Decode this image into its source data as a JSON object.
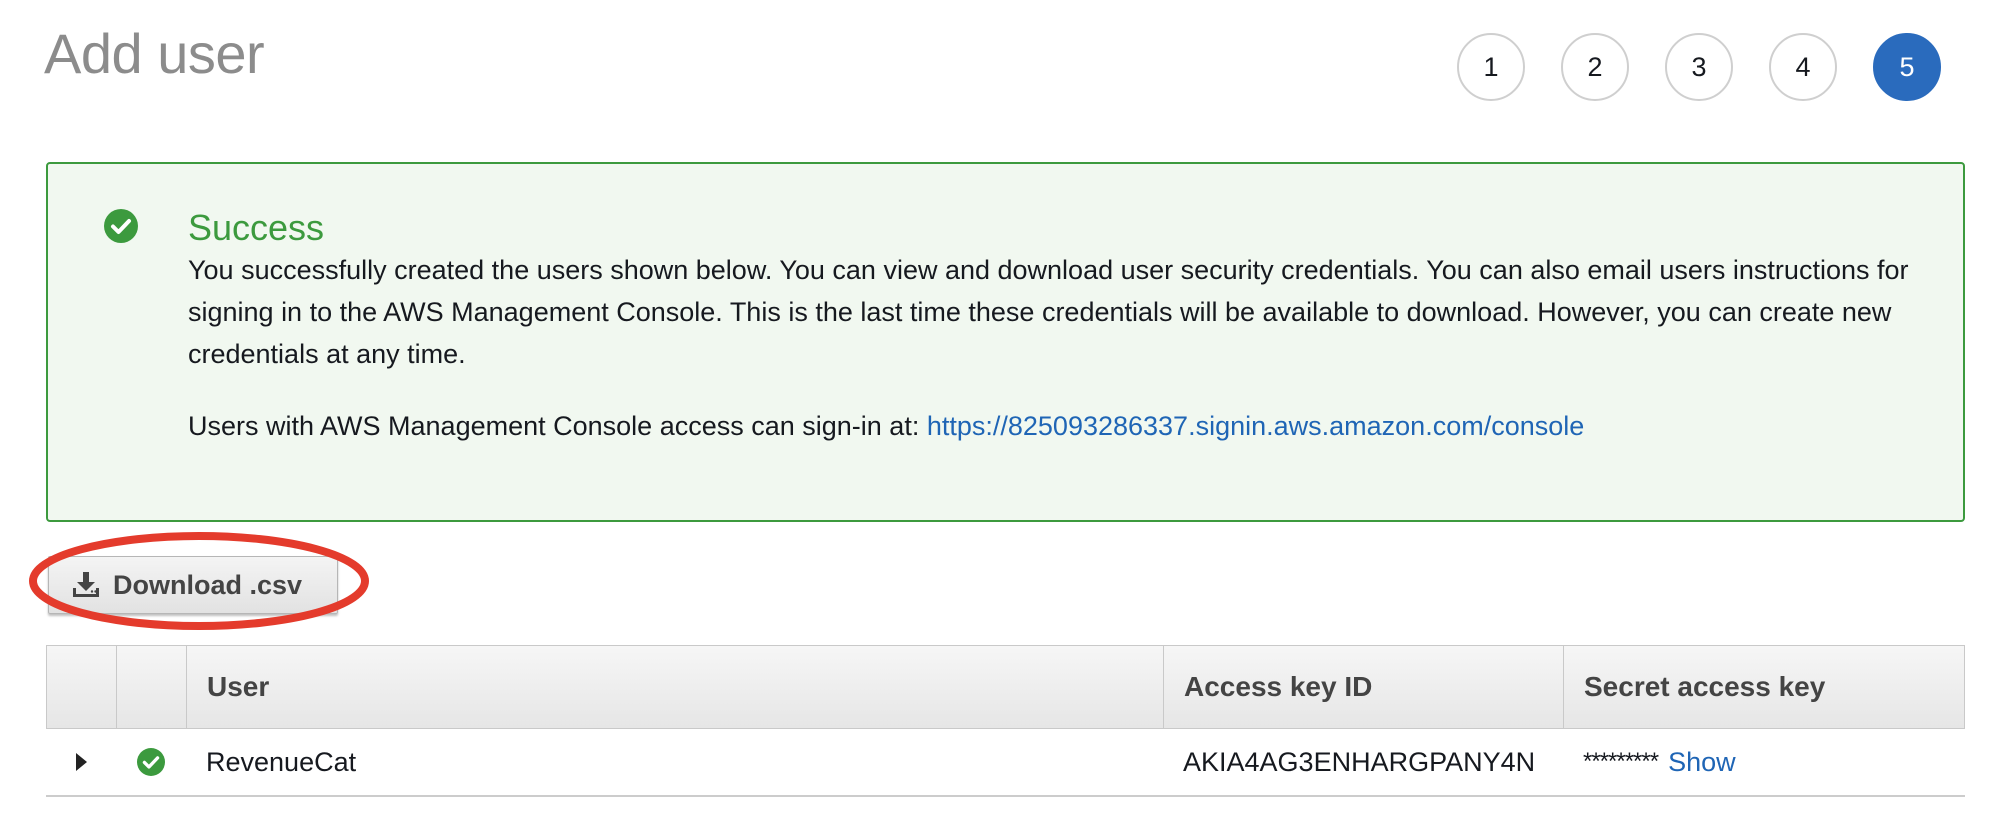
{
  "header": {
    "title": "Add user",
    "steps": [
      {
        "label": "1",
        "active": false
      },
      {
        "label": "2",
        "active": false
      },
      {
        "label": "3",
        "active": false
      },
      {
        "label": "4",
        "active": false
      },
      {
        "label": "5",
        "active": true
      }
    ]
  },
  "alert": {
    "icon": "check-circle-icon",
    "title": "Success",
    "body": "You successfully created the users shown below. You can view and download user security credentials. You can also email users instructions for signing in to the AWS Management Console. This is the last time these credentials will be available to download. However, you can create new credentials at any time.",
    "signin_prefix": "Users with AWS Management Console access can sign-in at:",
    "signin_url": "https://825093286337.signin.aws.amazon.com/console"
  },
  "toolbar": {
    "download_label": "Download .csv",
    "download_icon": "download-icon"
  },
  "table": {
    "columns": [
      "",
      "",
      "User",
      "Access key ID",
      "Secret access key"
    ],
    "rows": [
      {
        "user": "RevenueCat",
        "access_key_id": "AKIA4AG3ENHARGPANY4N",
        "secret_masked": "*********",
        "show_label": "Show",
        "status_icon": "check-circle-icon",
        "expand_icon": "caret-right-icon"
      }
    ]
  },
  "colors": {
    "success_green": "#3c9a3e",
    "alert_background": "#f1f8f0",
    "active_step_blue": "#2a6bbd",
    "link_blue": "#1f65b5",
    "annotation_red": "#e43b2c"
  }
}
